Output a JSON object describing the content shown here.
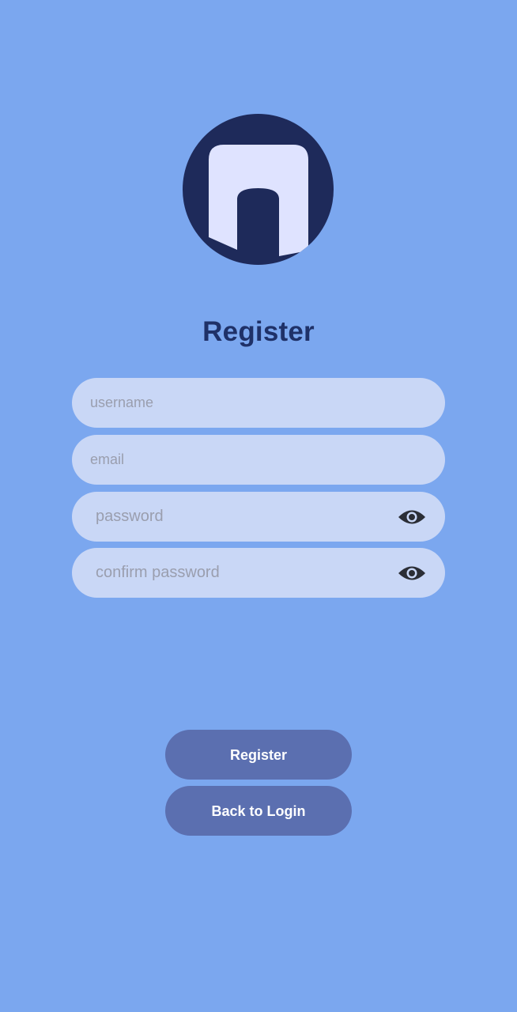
{
  "app": {
    "logo_icon": "m-logo-icon",
    "colors": {
      "background": "#7ba7ef",
      "logo_circle": "#1e2a5a",
      "logo_letter": "#dfe3ff",
      "title": "#1f3168",
      "field_background": "#c9d7f6",
      "button_background": "#5b6fb0",
      "button_text": "#ffffff"
    }
  },
  "form": {
    "title": "Register",
    "username": {
      "value": "",
      "placeholder": "username"
    },
    "email": {
      "value": "",
      "placeholder": "email"
    },
    "password": {
      "value": "",
      "placeholder": "password",
      "toggle_icon": "eye-icon"
    },
    "confirm_password": {
      "value": "",
      "placeholder": "confirm password",
      "toggle_icon": "eye-icon"
    }
  },
  "actions": {
    "register_label": "Register",
    "back_label": "Back to Login"
  }
}
